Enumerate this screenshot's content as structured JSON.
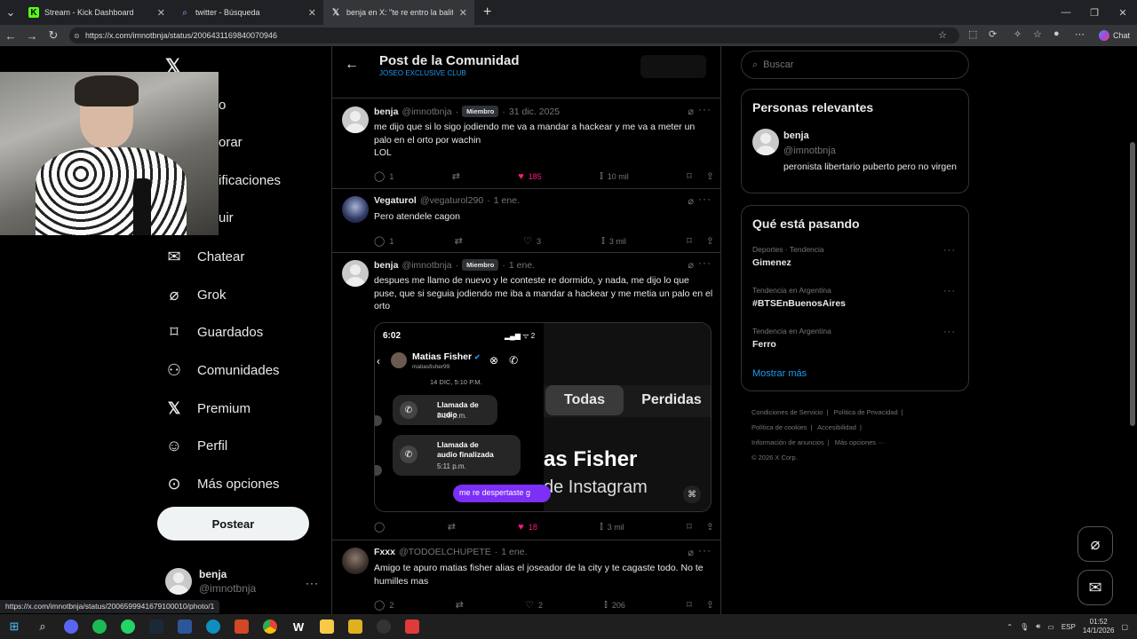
{
  "browser": {
    "tabs": [
      {
        "title": "Stream - Kick Dashboard",
        "icon": "kick-icon"
      },
      {
        "title": "twitter - Búsqueda",
        "icon": "search-icon"
      },
      {
        "title": "benja en X: \"te re entro la balita m...",
        "icon": "x-logo-icon"
      }
    ],
    "url": "https://x.com/imnotbnja/status/2006431169840070946",
    "chat_label": "Chat",
    "status_url": "https://x.com/imnotbnja/status/2006599941679100010/photo/1"
  },
  "nav": {
    "partial_items": [
      "o",
      "orar",
      "ificaciones",
      "uir"
    ],
    "items": [
      {
        "label": "Chatear",
        "icon": "mail-icon"
      },
      {
        "label": "Grok",
        "icon": "grok-icon"
      },
      {
        "label": "Guardados",
        "icon": "bookmark-icon"
      },
      {
        "label": "Comunidades",
        "icon": "communities-icon"
      },
      {
        "label": "Premium",
        "icon": "x-logo-icon"
      },
      {
        "label": "Perfil",
        "icon": "person-icon"
      },
      {
        "label": "Más opciones",
        "icon": "more-circle-icon"
      }
    ],
    "post_button": "Postear",
    "account": {
      "name": "benja",
      "handle": "@imnotbnja",
      "more": "···"
    }
  },
  "header": {
    "title": "Post de la Comunidad",
    "subtitle": "JOSEO EXCLUSIVE CLUB"
  },
  "tweets": [
    {
      "name": "benja",
      "handle": "@imnotbnja",
      "badge": "Miembro",
      "sep": "·",
      "date": "31 dic. 2025",
      "text": "me dijo que si lo sigo jodiendo me va a mandar a hackear y me va a meter un palo en el orto por wachin\nLOL",
      "replies": "1",
      "reposts": "",
      "likes": "185",
      "views": "10 mil",
      "liked": true
    },
    {
      "name": "Vegaturol",
      "handle": "@vegaturol290",
      "badge": "",
      "sep": "·",
      "date": "1 ene.",
      "text": "Pero atendele cagon",
      "replies": "1",
      "reposts": "",
      "likes": "3",
      "views": "3 mil",
      "liked": false
    },
    {
      "name": "benja",
      "handle": "@imnotbnja",
      "badge": "Miembro",
      "sep": "·",
      "date": "1 ene.",
      "text": "despues me llamo de nuevo y le conteste re dormido, y nada, me dijo lo que puse, que si seguia jodiendo me iba a mandar a hackear y me metia un palo en el orto",
      "replies": "",
      "reposts": "",
      "likes": "18",
      "views": "3 mil",
      "liked": true
    },
    {
      "name": "Fxxx",
      "handle": "@TODOELCHUPETE",
      "badge": "",
      "sep": "·",
      "date": "1 ene.",
      "text": "Amigo te apuro matias fisher alias el joseador de la city y te cagaste todo. No te humilles mas",
      "replies": "2",
      "reposts": "",
      "likes": "2",
      "views": "206",
      "liked": false
    }
  ],
  "media": {
    "time": "6:02",
    "status": "▂▄▆ ᯤ 2",
    "contact_name": "Matias Fisher",
    "contact_handle": "matiasfisher99",
    "date": "14 DIC, 5:10 P.M.",
    "call1_label": "Llamada de audio",
    "call1_time": "5:10 p.m.",
    "call2_label": "Llamada de\naudio finalizada",
    "call2_time": "5:11 p.m.",
    "message": "me re despertaste g",
    "tab_all": "Todas",
    "tab_missed": "Perdidas",
    "big_name": "as Fisher",
    "big_sub": "de Instagram"
  },
  "sidebar": {
    "search_placeholder": "Buscar",
    "relevant": {
      "title": "Personas relevantes",
      "name": "benja",
      "handle": "@imnotbnja",
      "bio": "peronista libertario puberto pero no virgen"
    },
    "trending": {
      "title": "Qué está pasando",
      "items": [
        {
          "category": "Deportes · Tendencia",
          "name": "Gimenez"
        },
        {
          "category": "Tendencia en Argentina",
          "name": "#BTSEnBuenosAires"
        },
        {
          "category": "Tendencia en Argentina",
          "name": "Ferro"
        }
      ],
      "show_more": "Mostrar más"
    },
    "footer": {
      "row1": [
        "Condiciones de Servicio",
        "|",
        "Política de Privacidad",
        "|"
      ],
      "row2": [
        "Política de cookies",
        "|",
        "Accesibilidad",
        "|"
      ],
      "row3": [
        "Información de anuncios",
        "|",
        "Más opciones ···"
      ],
      "copyright": "© 2026 X Corp."
    }
  },
  "taskbar": {
    "lang": "ESP",
    "time": "01:52",
    "date": "14/1/2026"
  }
}
